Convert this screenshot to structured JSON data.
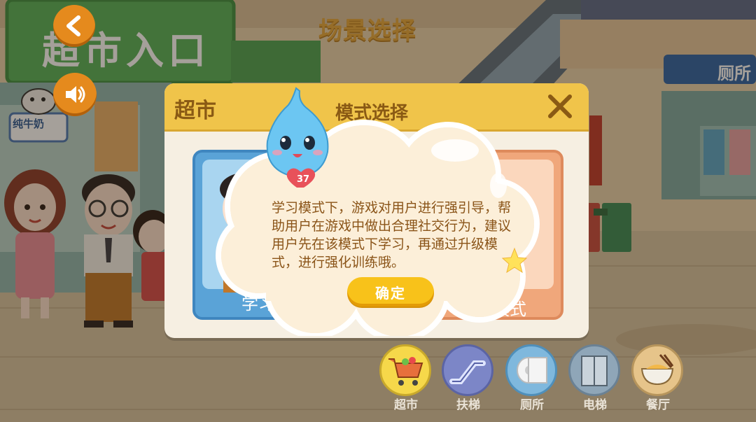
{
  "background": {
    "title": "场景选择",
    "store_sign": "超市入口",
    "milk_sign": "纯牛奶",
    "toilet_sign": "厕所"
  },
  "top_controls": {
    "back_icon": "back-arrow-icon",
    "sound_icon": "speaker-icon"
  },
  "mode_panel": {
    "scene_name": "超市",
    "title": "模式选择",
    "close_icon": "close-x-icon",
    "left_card_label": "学习模式",
    "right_card_label": "模式"
  },
  "mascot": {
    "badge_number": "37"
  },
  "dialog": {
    "message": "学习模式下，游戏对用户进行强引导，帮助用户在游戏中做出合理社交行为，建议用户先在该模式下学习，再通过升级模式，进行强化训练哦。",
    "confirm_label": "确定"
  },
  "scene_nav": [
    {
      "label": "超市",
      "icon": "shopping-cart-icon"
    },
    {
      "label": "扶梯",
      "icon": "escalator-icon"
    },
    {
      "label": "厕所",
      "icon": "toilet-paper-icon"
    },
    {
      "label": "电梯",
      "icon": "elevator-icon"
    },
    {
      "label": "餐厅",
      "icon": "noodle-bowl-icon"
    }
  ],
  "colors": {
    "panel_header": "#f0c44a",
    "panel_body": "#f6efe2",
    "confirm_button": "#f8c21a",
    "dialog_cloud": "#fdf1dc",
    "mascot_blue": "#6cc6f2"
  }
}
